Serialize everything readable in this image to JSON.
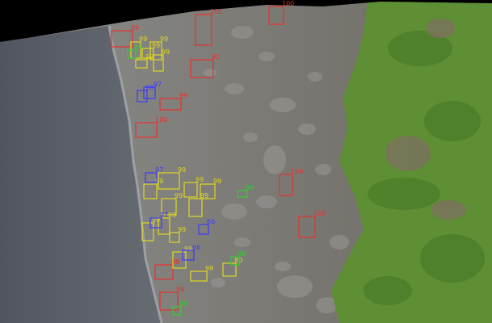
{
  "image": {
    "colors": {
      "water": "#5b6066",
      "beach": "#8d8f8f",
      "rocks": "#777672",
      "grass": "#5e8f34",
      "void": "#000000"
    }
  },
  "detections": [
    {
      "cls": "red",
      "score": "100"
    },
    {
      "cls": "red",
      "score": "100"
    },
    {
      "cls": "red",
      "score": "99"
    },
    {
      "cls": "red",
      "score": "92"
    },
    {
      "cls": "red",
      "score": "99"
    },
    {
      "cls": "red",
      "score": "100"
    },
    {
      "cls": "red",
      "score": "100"
    },
    {
      "cls": "red",
      "score": "100"
    },
    {
      "cls": "red",
      "score": "99"
    },
    {
      "cls": "red",
      "score": "99"
    },
    {
      "cls": "yellow",
      "score": "99"
    },
    {
      "cls": "yellow",
      "score": "99"
    },
    {
      "cls": "yellow",
      "score": "99"
    },
    {
      "cls": "yellow",
      "score": "99"
    },
    {
      "cls": "yellow",
      "score": "99"
    },
    {
      "cls": "yellow",
      "score": "99"
    },
    {
      "cls": "yellow",
      "score": "99"
    },
    {
      "cls": "yellow",
      "score": "99"
    },
    {
      "cls": "yellow",
      "score": "99"
    },
    {
      "cls": "yellow",
      "score": "99"
    },
    {
      "cls": "yellow",
      "score": "99"
    },
    {
      "cls": "yellow",
      "score": "99"
    },
    {
      "cls": "yellow",
      "score": "99"
    },
    {
      "cls": "yellow",
      "score": "80"
    },
    {
      "cls": "yellow",
      "score": "99"
    },
    {
      "cls": "yellow",
      "score": "99"
    },
    {
      "cls": "yellow",
      "score": "99"
    },
    {
      "cls": "blue",
      "score": "99"
    },
    {
      "cls": "blue",
      "score": "97"
    },
    {
      "cls": "blue",
      "score": "97"
    },
    {
      "cls": "blue",
      "score": "66"
    },
    {
      "cls": "blue",
      "score": "66"
    },
    {
      "cls": "blue",
      "score": "97"
    },
    {
      "cls": "green",
      "score": "99"
    },
    {
      "cls": "green",
      "score": "98"
    },
    {
      "cls": "green",
      "score": "99"
    },
    {
      "cls": "green",
      "score": "99"
    }
  ],
  "class_colors": {
    "red": "#e8312d",
    "yellow": "#e0d820",
    "blue": "#3a3aff",
    "green": "#2fd02f"
  }
}
